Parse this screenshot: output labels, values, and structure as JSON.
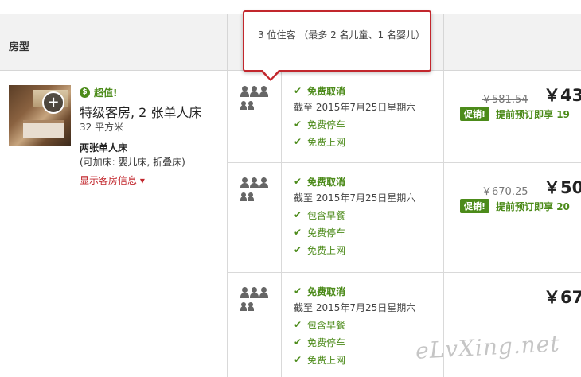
{
  "header": {
    "room_type_label": "房型"
  },
  "tooltip": {
    "text": "3 位住客 （最多 2 名儿童、1 名婴儿）"
  },
  "room": {
    "deal_label": "超值!",
    "deal_icon": "dollar-coin-icon",
    "name": "特级客房, 2 张单人床",
    "size": "32 平方米",
    "bed_type": "两张单人床",
    "extra_bed": "(可加床: 婴儿床, 折叠床)",
    "show_info_link": "显示客房信息 ▾"
  },
  "offers": [
    {
      "features": [
        "免费取消"
      ],
      "deadline": "截至 2015年7月25日星期六",
      "extras": [
        "免费停车",
        "免费上网"
      ],
      "old_price": "￥581.54",
      "price": "￥43",
      "promo_tag": "促销!",
      "promo_text": "提前预订即享 19"
    },
    {
      "features": [
        "免费取消"
      ],
      "deadline": "截至 2015年7月25日星期六",
      "extras": [
        "包含早餐",
        "免费停车",
        "免费上网"
      ],
      "old_price": "￥670.25",
      "price": "￥50",
      "promo_tag": "促销!",
      "promo_text": "提前预订即享 20"
    },
    {
      "features": [
        "免费取消"
      ],
      "deadline": "截至 2015年7月25日星期六",
      "extras": [
        "包含早餐",
        "免费停车",
        "免费上网"
      ],
      "price": "￥67"
    }
  ],
  "watermark": "eLvXing.net",
  "colors": {
    "accent_red": "#c2272d",
    "accent_green": "#4c8b1a"
  }
}
